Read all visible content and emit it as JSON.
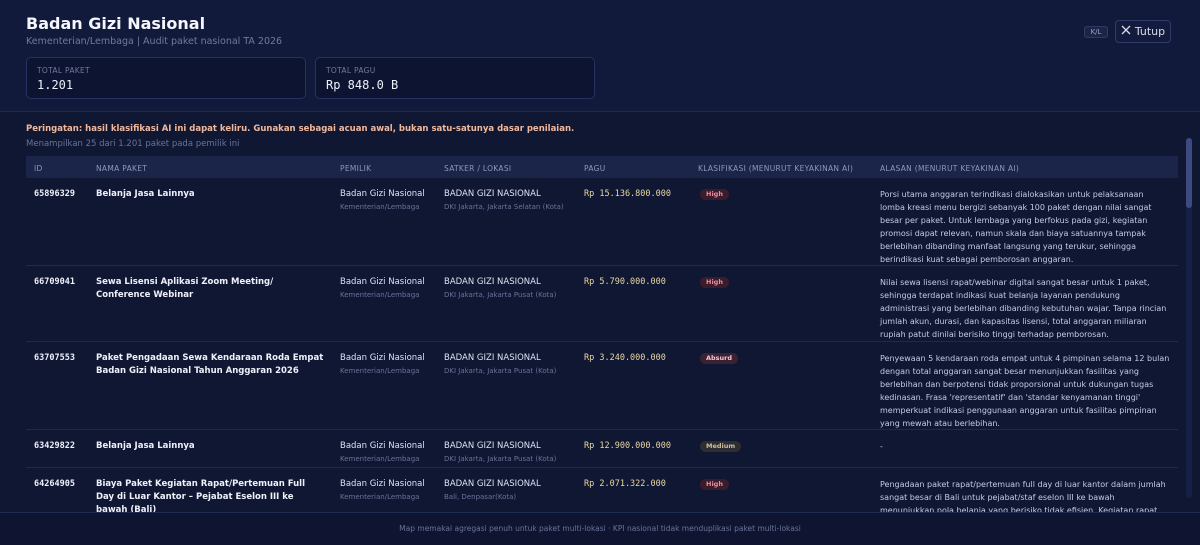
{
  "header": {
    "title": "Badan Gizi Nasional",
    "subtitle": "Kementerian/Lembaga | Audit paket nasional TA 2026",
    "kl_badge": "K/L",
    "close_label": "Tutup"
  },
  "kpis": [
    {
      "label": "TOTAL PAKET",
      "value": "1.201"
    },
    {
      "label": "TOTAL PAGU",
      "value": "Rp 848.0 B"
    }
  ],
  "warning": "Peringatan: hasil klasifikasi AI ini dapat keliru. Gunakan sebagai acuan awal, bukan satu-satunya dasar penilaian.",
  "showing": "Menampilkan 25 dari 1.201 paket pada pemilik ini",
  "columns": [
    "ID",
    "NAMA PAKET",
    "PEMILIK",
    "SATKER / LOKASI",
    "PAGU",
    "KLASIFIKASI (MENURUT KEYAKINAN AI)",
    "ALASAN (MENURUT KEYAKINAN AI)"
  ],
  "rows": [
    {
      "id": "65896329",
      "nama": "Belanja Jasa Lainnya",
      "pemilik": "Badan Gizi Nasional",
      "pemilik_sub": "Kementerian/Lembaga",
      "satker": "BADAN GIZI NASIONAL",
      "lokasi": "DKI Jakarta, Jakarta Selatan (Kota)",
      "pagu": "Rp 15.136.800.000",
      "klasifikasi": "High",
      "alasan": "Porsi utama anggaran terindikasi dialokasikan untuk pelaksanaan lomba kreasi menu bergizi sebanyak 100 paket dengan nilai sangat besar per paket. Untuk lembaga yang berfokus pada gizi, kegiatan promosi dapat relevan, namun skala dan biaya satuannya tampak berlebihan dibanding manfaat langsung yang terukur, sehingga berindikasi kuat sebagai pemborosan anggaran."
    },
    {
      "id": "66709041",
      "nama": "Sewa Lisensi Aplikasi Zoom Meeting/ Conference Webinar",
      "pemilik": "Badan Gizi Nasional",
      "pemilik_sub": "Kementerian/Lembaga",
      "satker": "BADAN GIZI NASIONAL",
      "lokasi": "DKI Jakarta, Jakarta Pusat (Kota)",
      "pagu": "Rp 5.790.000.000",
      "klasifikasi": "High",
      "alasan": "Nilai sewa lisensi rapat/webinar digital sangat besar untuk 1 paket, sehingga terdapat indikasi kuat belanja layanan pendukung administrasi yang berlebihan dibanding kebutuhan wajar. Tanpa rincian jumlah akun, durasi, dan kapasitas lisensi, total anggaran miliaran rupiah patut dinilai berisiko tinggi terhadap pemborosan."
    },
    {
      "id": "63707553",
      "nama": "Paket Pengadaan Sewa Kendaraan Roda Empat Badan Gizi Nasional Tahun Anggaran 2026",
      "pemilik": "Badan Gizi Nasional",
      "pemilik_sub": "Kementerian/Lembaga",
      "satker": "BADAN GIZI NASIONAL",
      "lokasi": "DKI Jakarta, Jakarta Pusat (Kota)",
      "pagu": "Rp 3.240.000.000",
      "klasifikasi": "Absurd",
      "alasan": "Penyewaan 5 kendaraan roda empat untuk 4 pimpinan selama 12 bulan dengan total anggaran sangat besar menunjukkan fasilitas yang berlebihan dan berpotensi tidak proporsional untuk dukungan tugas kedinasan. Frasa 'representatif' dan 'standar kenyamanan tinggi' memperkuat indikasi penggunaan anggaran untuk fasilitas pimpinan yang mewah atau berlebihan."
    },
    {
      "id": "63429822",
      "nama": "Belanja Jasa Lainnya",
      "pemilik": "Badan Gizi Nasional",
      "pemilik_sub": "Kementerian/Lembaga",
      "satker": "BADAN GIZI NASIONAL",
      "lokasi": "DKI Jakarta, Jakarta Pusat (Kota)",
      "pagu": "Rp 12.900.000.000",
      "klasifikasi": "Medium",
      "alasan": "-"
    },
    {
      "id": "64264905",
      "nama": "Biaya Paket Kegiatan Rapat/Pertemuan Full Day di Luar Kantor – Pejabat Eselon III ke bawah (Bali)",
      "pemilik": "Badan Gizi Nasional",
      "pemilik_sub": "Kementerian/Lembaga",
      "satker": "BADAN GIZI NASIONAL",
      "lokasi": "Bali, Denpasar(Kota)",
      "pagu": "Rp 2.071.322.000",
      "klasifikasi": "High",
      "alasan": "Pengadaan paket rapat/pertemuan full day di luar kantor dalam jumlah sangat besar di Bali untuk pejabat/staf eselon III ke bawah menunjukkan pola belanja yang berisiko tidak efisien. Kegiatan rapat internal umumnya dapat"
    }
  ],
  "footer": "Map memakai agregasi penuh untuk paket multi-lokasi · KPI nasional tidak menduplikasi paket multi-lokasi"
}
